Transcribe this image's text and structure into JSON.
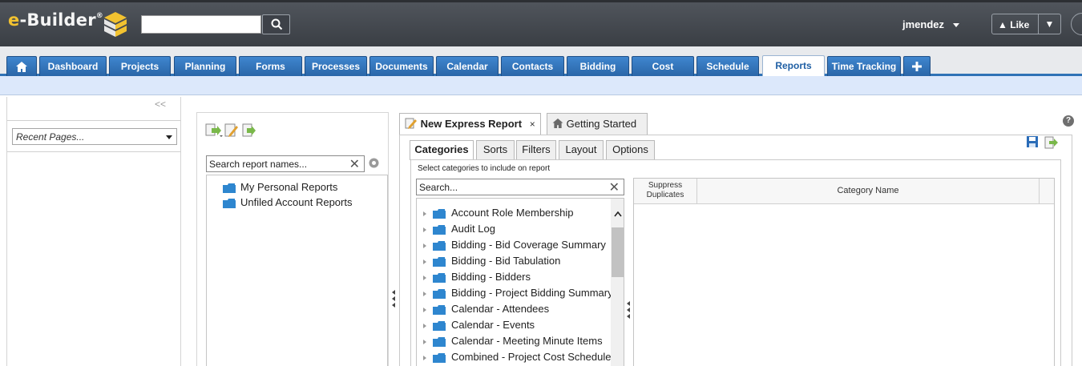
{
  "app": {
    "logo_text": "e-Builder",
    "logo_mark": "®",
    "user_name": "jmendez",
    "like_label": "Like"
  },
  "colors": {
    "topbar": "#44484e",
    "nav_tab": "#2f72b6",
    "subbar": "#dce8fb"
  },
  "nav": {
    "tabs": [
      {
        "label": "Dashboard"
      },
      {
        "label": "Projects"
      },
      {
        "label": "Planning"
      },
      {
        "label": "Forms"
      },
      {
        "label": "Processes"
      },
      {
        "label": "Documents"
      },
      {
        "label": "Calendar"
      },
      {
        "label": "Contacts"
      },
      {
        "label": "Bidding"
      },
      {
        "label": "Cost"
      },
      {
        "label": "Schedule"
      },
      {
        "label": "Reports"
      },
      {
        "label": "Time Tracking"
      }
    ],
    "active_tab": "Reports"
  },
  "sidebar": {
    "collapse_glyph": "<<",
    "recent_pages_placeholder": "Recent Pages..."
  },
  "reports": {
    "search_placeholder": "Search report names...",
    "folders": [
      {
        "label": "My Personal Reports"
      },
      {
        "label": "Unfiled Account Reports"
      }
    ]
  },
  "express": {
    "tabs": [
      {
        "label": "New Express Report",
        "close": "×"
      },
      {
        "label": "Getting Started"
      }
    ],
    "subtabs": [
      {
        "label": "Categories"
      },
      {
        "label": "Sorts"
      },
      {
        "label": "Filters"
      },
      {
        "label": "Layout"
      },
      {
        "label": "Options"
      }
    ],
    "active_subtab": "Categories",
    "hint": "Select categories to include on report",
    "category_search_placeholder": "Search...",
    "categories": [
      {
        "label": "Account Role Membership"
      },
      {
        "label": "Audit Log"
      },
      {
        "label": "Bidding - Bid Coverage Summary"
      },
      {
        "label": "Bidding - Bid Tabulation"
      },
      {
        "label": "Bidding - Bidders"
      },
      {
        "label": "Bidding - Project Bidding Summary"
      },
      {
        "label": "Calendar - Attendees"
      },
      {
        "label": "Calendar - Events"
      },
      {
        "label": "Calendar - Meeting Minute Items"
      },
      {
        "label": "Combined - Project Cost Schedule"
      }
    ],
    "grid": {
      "col_suppress": "Suppress Duplicates",
      "col_name": "Category Name"
    }
  },
  "icons": {
    "home": "home-icon",
    "search": "search-icon",
    "add": "plus-icon",
    "help": "help-icon",
    "save": "save-icon",
    "export": "export-icon",
    "settings": "gear-icon",
    "folder": "folder-icon"
  }
}
